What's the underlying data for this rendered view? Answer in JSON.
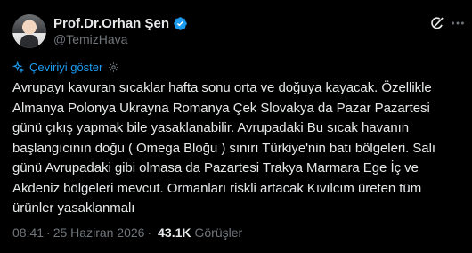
{
  "author": {
    "display_name": "Prof.Dr.Orhan Şen",
    "handle": "@TemizHava",
    "verified": true,
    "verified_color": "#1d9bf0"
  },
  "actions": {
    "grok_icon": "grok-icon",
    "more_icon": "more-icon"
  },
  "translate": {
    "label": "Çeviriyi göster",
    "color": "#1d9bf0"
  },
  "tweet": {
    "lines": [
      "Avrupayı kavuran sıcaklar hafta sonu orta ve doğuya kayacak. Özellikle",
      "Almanya Polonya Ukrayna Romanya Çek Slovakya da Pazar Pazartesi",
      "günü çıkış yapmak bile yasaklanabilir. Avrupadaki Bu sıcak havanın",
      "başlangıcının doğu ( Omega Bloğu ) sınırı Türkiye'nin batı bölgeleri. Salı",
      "günü Avrupadaki gibi olmasa da Pazartesi Trakya Marmara Ege İç ve",
      "Akdeniz bölgeleri mevcut. Ormanları riskli artacak Kıvılcım üreten tüm",
      "ürünler yasaklanmalı"
    ]
  },
  "meta": {
    "time": "08:41",
    "separator": "·",
    "date": "25 Haziran 2026",
    "views_count": "43.1K",
    "views_label": "Görüşler"
  },
  "colors": {
    "background": "#000000",
    "text": "#e7e9ea",
    "muted": "#71767b",
    "accent": "#1d9bf0"
  }
}
